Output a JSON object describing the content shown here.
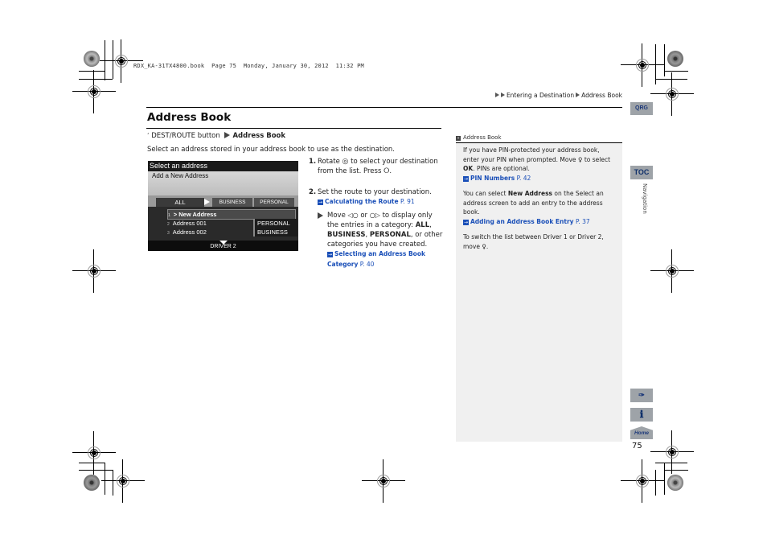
{
  "slug_line": "RDX_KA-31TX4800.book  Page 75  Monday, January 30, 2012  11:32 PM",
  "breadcrumb": [
    "Entering a Destination",
    "Address Book"
  ],
  "title": "Address Book",
  "path": {
    "prefix": "DEST/ROUTE button",
    "target": "Address Book"
  },
  "intro": "Select an address stored in your address book to use as the destination.",
  "screen": {
    "header": "Select an address",
    "add_new": "Add a New Address",
    "tabs": [
      "ALL",
      "BUSINESS",
      "PERSONAL"
    ],
    "rows": [
      {
        "num": "1",
        "label": "> New Address",
        "category": ""
      },
      {
        "num": "2",
        "label": "Address 001",
        "category": "PERSONAL"
      },
      {
        "num": "3",
        "label": "Address 002",
        "category": "BUSINESS"
      }
    ],
    "footer": "DRIVER 2"
  },
  "steps": [
    {
      "num": "1.",
      "pre": "Rotate",
      "mid": "to select your destination from the list. Press",
      "post": "."
    },
    {
      "num": "2.",
      "text": "Set the route to your destination.",
      "link": "Calculating the Route",
      "page": "P. 91"
    }
  ],
  "sub_bullet": {
    "pre": "Move",
    "or": "or",
    "mid": "to display only the entries in a category:",
    "cat_all": "ALL",
    "cat_business": "BUSINESS",
    "cat_personal": "PERSONAL",
    "post": ", or other categories you have created.",
    "link": "Selecting an Address Book Category",
    "page": "P. 40"
  },
  "sidebar": {
    "heading": "Address Book",
    "p1_text": "If you have PIN-protected your address book, enter your PIN when prompted. Move",
    "p1_to": "to select",
    "p1_ok": "OK",
    "p1_post": ". PINs are optional.",
    "p1_link": "PIN Numbers",
    "p1_page": "P. 42",
    "p2_pre": "You can select",
    "p2_bold": "New Address",
    "p2_post": "on the Select an address screen to add an entry to the address book.",
    "p2_link": "Adding an Address Book Entry",
    "p2_page": "P. 37",
    "p3_text": "To switch the list between Driver 1 or Driver 2, move"
  },
  "side_tabs": {
    "qrg": "QRG",
    "toc": "TOC",
    "section": "Navigation",
    "home": "Home"
  },
  "page_number": "75"
}
